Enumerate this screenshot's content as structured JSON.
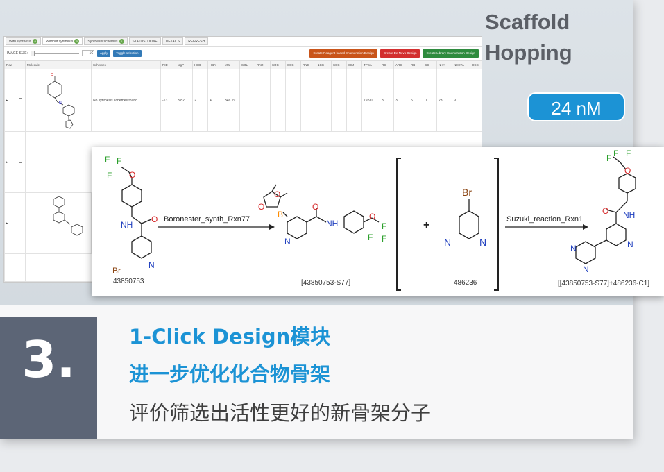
{
  "header": {
    "title": "Scaffold\nHopping",
    "potency": "24 nM"
  },
  "step": {
    "number": "3.",
    "line1": "1-Click Design模块",
    "line2": "进一步优化化合物骨架",
    "line3": "评价筛选出活性更好的新骨架分子"
  },
  "app": {
    "tabs": [
      {
        "label": "With synthesis",
        "count": "0"
      },
      {
        "label": "Without synthesis",
        "count": "0"
      },
      {
        "label": "Synthesis schemes",
        "count": "0"
      },
      {
        "label": "STATUS: DONE",
        "count": ""
      },
      {
        "label": "DETAILS",
        "count": ""
      },
      {
        "label": "REFRESH",
        "count": ""
      }
    ],
    "image_size_label": "IMAGE SIZE:",
    "image_size_value": "1€",
    "apply_label": "Apply",
    "toggle_label": "Toggle selection",
    "actions": [
      "Create Reagent-based Enumeration Design",
      "Create De Novo Design",
      "Create Library Enumeration Design"
    ],
    "columns": [
      "Row",
      "",
      "Molecule",
      "Schemes",
      "RID",
      "logP",
      "HBD",
      "HBA",
      "MW",
      "SOL",
      "RAR",
      "SOC",
      "SCC",
      "RNC",
      "1CC",
      "SCC",
      "SIM",
      "TPSA",
      "RC",
      "ARC",
      "RB",
      "CC",
      "NHA",
      "NHETA",
      "HCC"
    ],
    "rows": [
      {
        "schemes": "No synthesis schemes found",
        "rid": "-13",
        "logp": "3.82",
        "hbd": "2",
        "hba": "4",
        "mw": "346.29",
        "tpsa": "79.90",
        "rc": "3",
        "arc": "3",
        "rb": "5",
        "cc": "0",
        "nha": "23",
        "nheta": "9"
      }
    ]
  },
  "scheme": {
    "reactions": [
      "Boronester_synth_Rxn77",
      "Suzuki_reaction_Rxn1"
    ],
    "compound_ids": [
      "43850753",
      "[43850753-S77]",
      "486236",
      "[[43850753-S77]+486236-C1]"
    ],
    "atoms": {
      "F": "F",
      "O": "O",
      "N": "N",
      "H": "H",
      "Br": "Br",
      "B": "B",
      "NH": "NH",
      "plus": "+"
    }
  }
}
